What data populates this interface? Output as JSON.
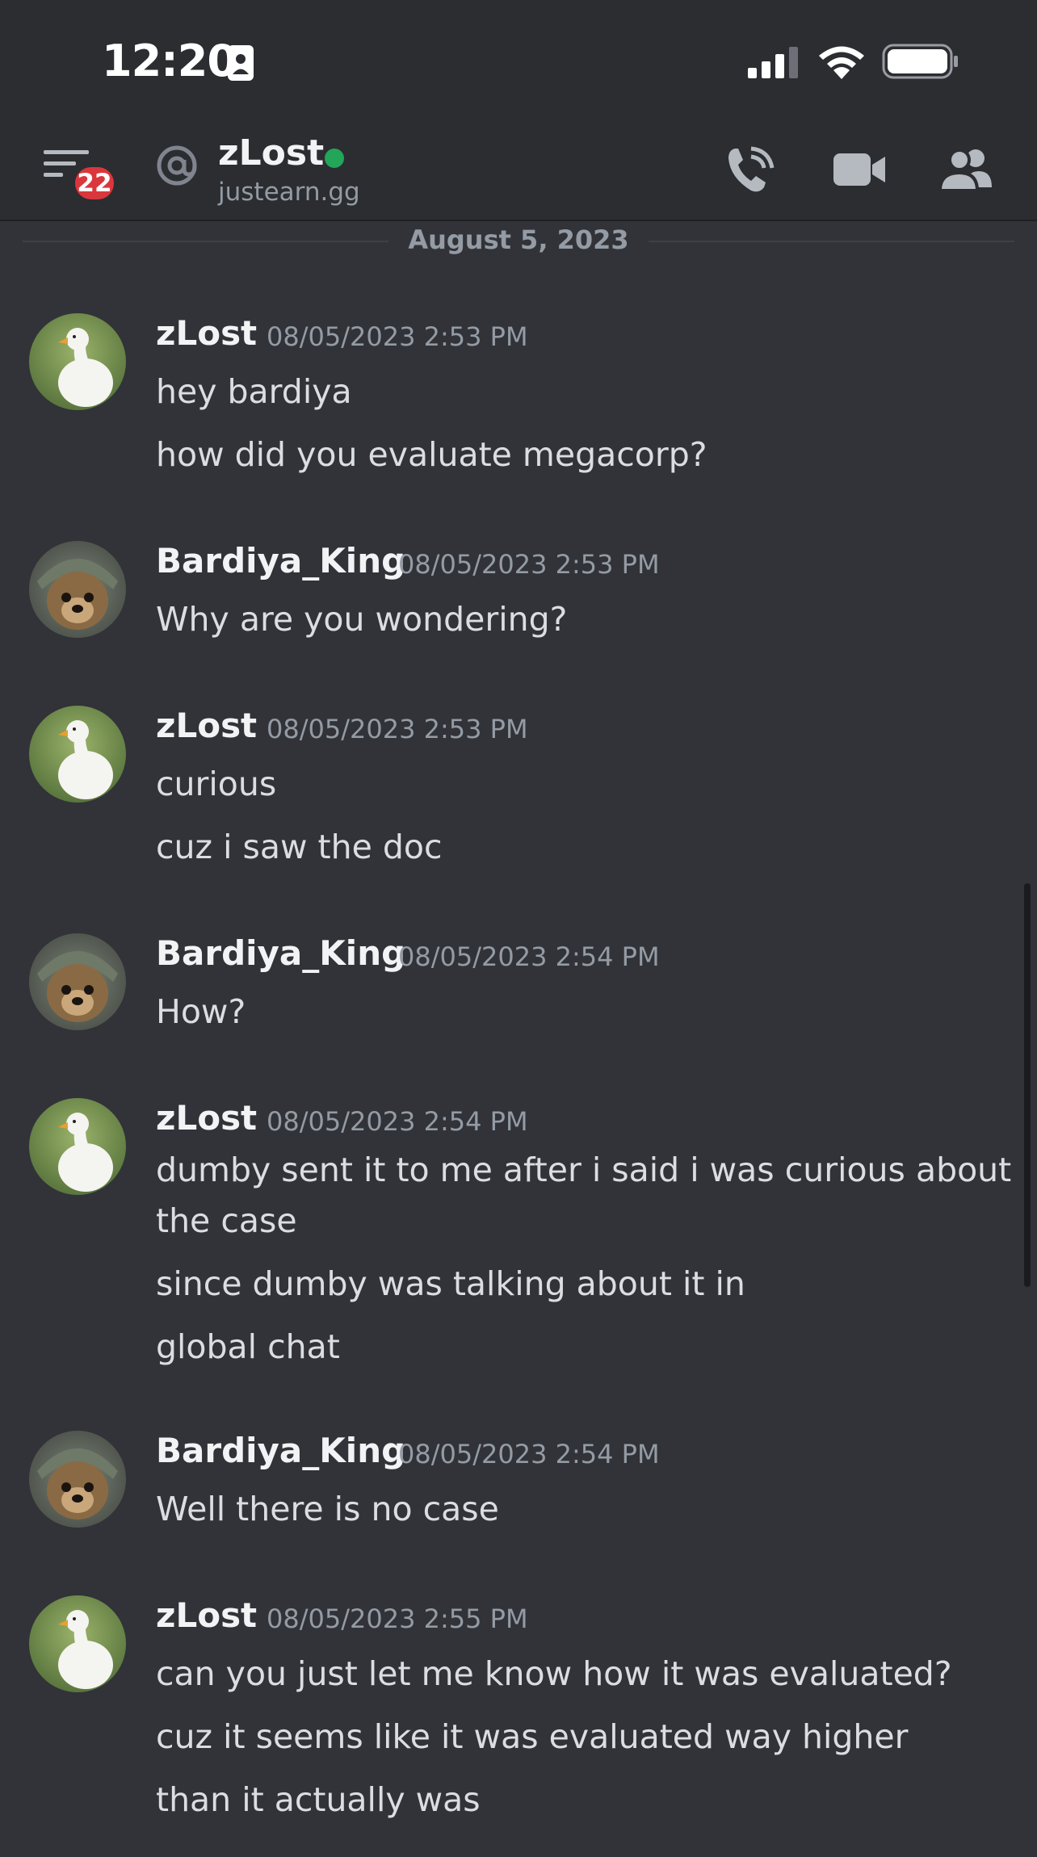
{
  "status": {
    "time": "12:20"
  },
  "header": {
    "badge_count": "22",
    "channel_name": "zLost",
    "channel_sub": "justearn.gg"
  },
  "date_divider": "August 5, 2023",
  "messages": [
    {
      "user": "zLost",
      "time": "08/05/2023 2:53 PM",
      "avatar": "duck-avatar",
      "lines": [
        "hey bardiya",
        "how did you evaluate megacorp?"
      ]
    },
    {
      "user": "Bardiya_King",
      "time": "08/05/2023 2:53 PM",
      "avatar": "dog-avatar",
      "lines": [
        "Why are you wondering?"
      ]
    },
    {
      "user": "zLost",
      "time": "08/05/2023 2:53 PM",
      "avatar": "duck-avatar",
      "lines": [
        "curious",
        "cuz i saw the doc"
      ]
    },
    {
      "user": "Bardiya_King",
      "time": "08/05/2023 2:54 PM",
      "avatar": "dog-avatar",
      "lines": [
        "How?"
      ]
    },
    {
      "user": "zLost",
      "time": "08/05/2023 2:54 PM",
      "avatar": "duck-avatar",
      "lines": [
        "dumby sent it to me after i said i was curious about",
        "the case",
        "since dumby was talking about it in",
        "global chat"
      ]
    },
    {
      "user": "Bardiya_King",
      "time": "08/05/2023 2:54 PM",
      "avatar": "dog-avatar",
      "lines": [
        "Well there is no case"
      ]
    },
    {
      "user": "zLost",
      "time": "08/05/2023 2:55 PM",
      "avatar": "duck-avatar",
      "lines": [
        "can you just let me know how it was evaluated?",
        "cuz it seems like it was evaluated way higher",
        "than it actually was"
      ]
    }
  ]
}
